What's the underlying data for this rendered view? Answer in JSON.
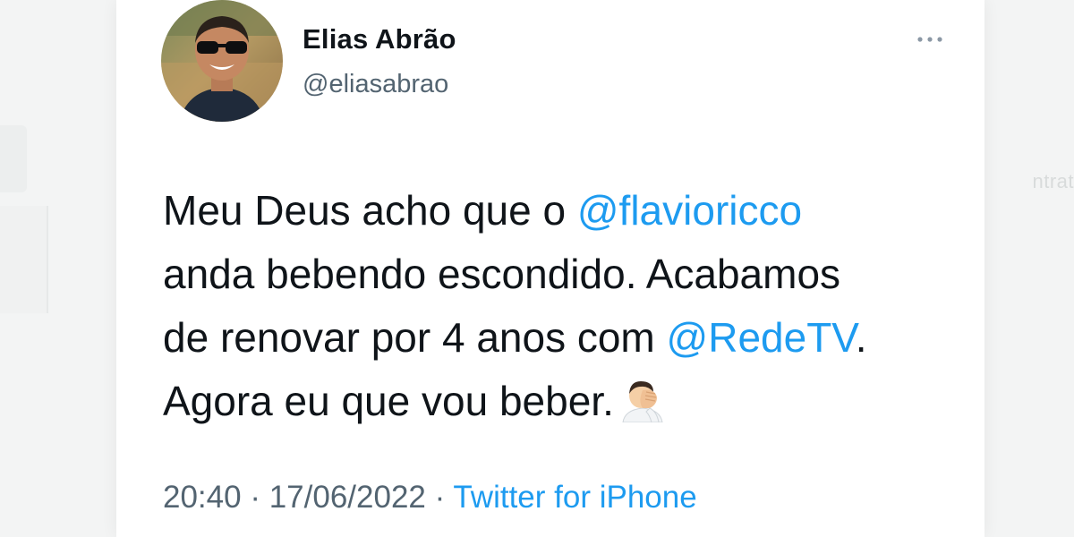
{
  "author": {
    "display_name": "Elias Abrão",
    "handle": "@eliasabrao",
    "avatar_icon": "profile-photo"
  },
  "more_icon": "more-horizontal-icon",
  "tweet": {
    "line1_prefix": "Meu Deus acho que o ",
    "line1_mention": "@flavioricco",
    "line2": "anda bebendo escondido. Acabamos",
    "line3_prefix": "de renovar por 4 anos com ",
    "line3_mention": "@RedeTV",
    "line3_suffix": ".",
    "line4": "Agora eu que vou beber.",
    "emoji_icon": "man-facepalming-emoji"
  },
  "meta": {
    "time": "20:40",
    "separator1": " · ",
    "date": "17/06/2022",
    "separator2": " · ",
    "source": "Twitter for iPhone"
  },
  "background": {
    "right_partial_text": "ntrat"
  },
  "colors": {
    "link": "#1d9bf0",
    "text": "#0f1419",
    "secondary": "#536471",
    "card": "#ffffff",
    "page_bg": "#f3f4f4"
  }
}
